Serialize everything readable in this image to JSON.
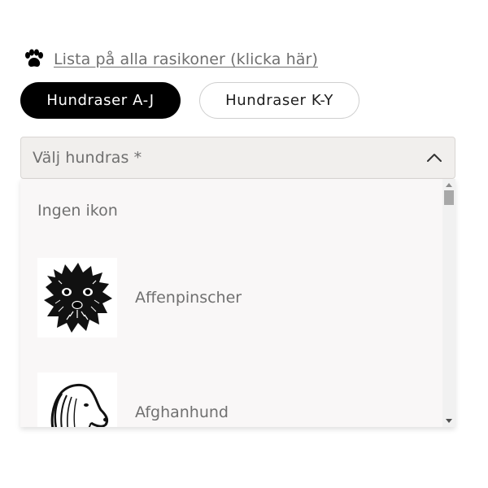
{
  "header": {
    "link_label": "Lista på alla rasikoner (klicka här)",
    "link_icon": "paw-icon"
  },
  "tabs": [
    {
      "label": "Hundraser A-J",
      "active": true
    },
    {
      "label": "Hundraser K-Y",
      "active": false
    }
  ],
  "select": {
    "placeholder": "Välj hundras *",
    "state": "open",
    "icon": "chevron-up-icon"
  },
  "dropdown": {
    "options": [
      {
        "label": "Ingen ikon",
        "icon": ""
      },
      {
        "label": "Affenpinscher",
        "icon": "affenpinscher-dog-icon"
      },
      {
        "label": "Afghanhund",
        "icon": "afghanhund-dog-icon"
      }
    ]
  },
  "colors": {
    "active_tab_bg": "#000000",
    "select_bg": "#f1efed",
    "dropdown_bg": "#f9f7f7",
    "text_muted": "#707070"
  }
}
